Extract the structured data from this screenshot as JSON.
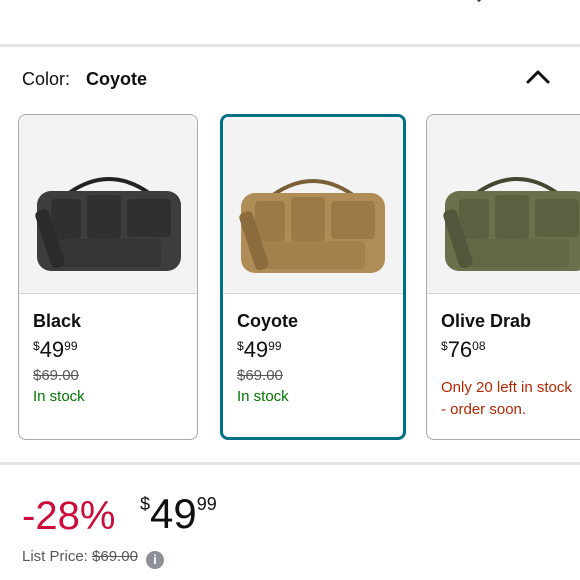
{
  "icons": {
    "top_left": "chevron-down-icon",
    "top_right": "share-icon",
    "collapse": "chevron-up-icon",
    "info": "info-icon"
  },
  "color_selector": {
    "label": "Color:",
    "selected_value": "Coyote",
    "options": [
      {
        "name": "Black",
        "price_symbol": "$",
        "price_whole": "49",
        "price_fraction": "99",
        "list_price": "$69.00",
        "availability": "In stock",
        "bag_color": "#3b3d3f"
      },
      {
        "name": "Coyote",
        "price_symbol": "$",
        "price_whole": "49",
        "price_fraction": "99",
        "list_price": "$69.00",
        "availability": "In stock",
        "bag_color": "#b08d57"
      },
      {
        "name": "Olive Drab",
        "price_symbol": "$",
        "price_whole": "76",
        "price_fraction": "08",
        "availability_line1": "Only 20 left in stock",
        "availability_line2": "- order soon.",
        "bag_color": "#6b6f4c"
      }
    ]
  },
  "price": {
    "discount": "-28%",
    "symbol": "$",
    "whole": "49",
    "fraction": "99",
    "list_price_label": "List Price:",
    "list_price_value": "$69.00"
  },
  "colors": {
    "selected_border": "#007185",
    "discount_red": "#cc0c39",
    "in_stock_green": "#007600",
    "low_stock_red": "#b12704"
  }
}
